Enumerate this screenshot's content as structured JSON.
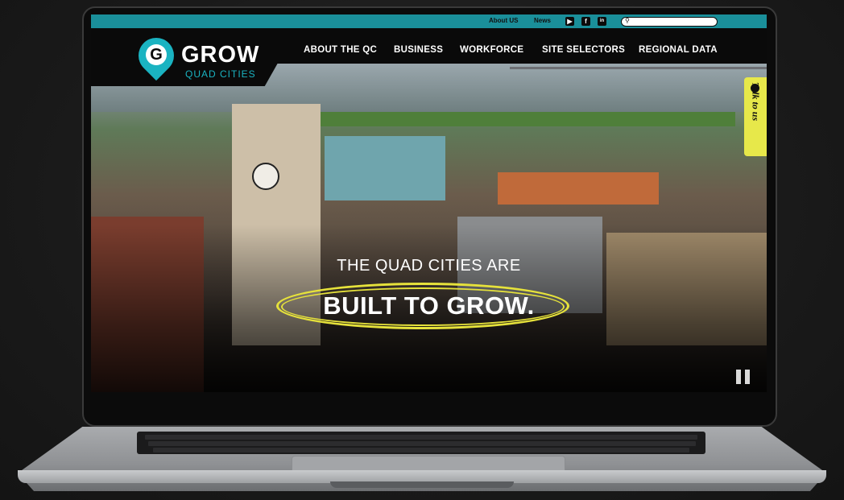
{
  "topbar": {
    "about_us": "About US",
    "news": "News",
    "social": [
      {
        "icon": "youtube-icon",
        "glyph": "▶"
      },
      {
        "icon": "facebook-icon",
        "glyph": "f"
      },
      {
        "icon": "linkedin-icon",
        "glyph": "in"
      }
    ],
    "search_placeholder": ""
  },
  "logo": {
    "title": "GROW",
    "subtitle": "QUAD CITIES",
    "mark": "G"
  },
  "nav": [
    {
      "label": "ABOUT THE QC"
    },
    {
      "label": "BUSINESS"
    },
    {
      "label": "WORKFORCE"
    },
    {
      "label": "SITE SELECTORS"
    },
    {
      "label": "REGIONAL DATA"
    }
  ],
  "hero": {
    "subtitle": "THE QUAD CITIES ARE",
    "headline": "BUILT TO GROW."
  },
  "talk_tab": {
    "label": "Talk to us"
  },
  "colors": {
    "accent": "#1ab3c1",
    "highlight": "#e6e23b",
    "nav_bg": "#0a0a0a"
  }
}
